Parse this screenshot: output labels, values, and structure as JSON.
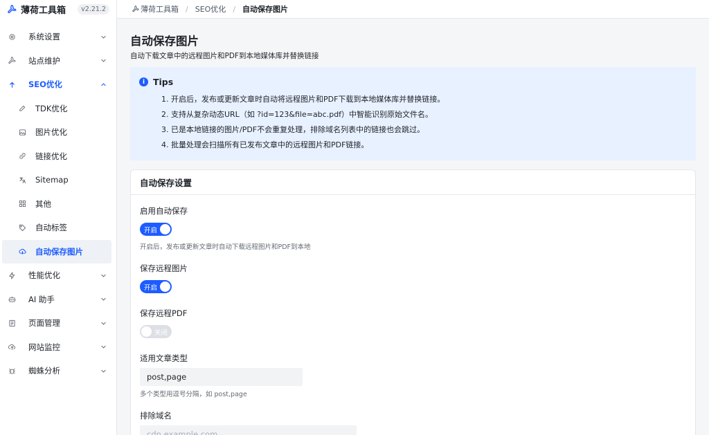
{
  "brand": {
    "name": "薄荷工具箱",
    "version": "v2.21.2"
  },
  "sidebar": {
    "items": [
      {
        "label": "系统设置",
        "icon": "gear-icon",
        "chevron": "down"
      },
      {
        "label": "站点维护",
        "icon": "wrench-icon",
        "chevron": "down"
      },
      {
        "label": "SEO优化",
        "icon": "arrow-up-icon",
        "chevron": "up",
        "active": true
      },
      {
        "label": "TDK优化",
        "icon": "pencil-icon",
        "sub": true
      },
      {
        "label": "图片优化",
        "icon": "image-icon",
        "sub": true
      },
      {
        "label": "链接优化",
        "icon": "link-icon",
        "sub": true
      },
      {
        "label": "Sitemap",
        "icon": "translate-icon",
        "sub": true
      },
      {
        "label": "其他",
        "icon": "grid-icon",
        "sub": true
      },
      {
        "label": "自动标签",
        "icon": "tag-icon",
        "sub": true
      },
      {
        "label": "自动保存图片",
        "icon": "cloud-save-icon",
        "sub": true,
        "selected": true
      },
      {
        "label": "性能优化",
        "icon": "bolt-icon",
        "chevron": "down"
      },
      {
        "label": "AI 助手",
        "icon": "robot-icon",
        "chevron": "down"
      },
      {
        "label": "页面管理",
        "icon": "page-icon",
        "chevron": "down"
      },
      {
        "label": "网站监控",
        "icon": "monitor-icon",
        "chevron": "down"
      },
      {
        "label": "蜘蛛分析",
        "icon": "bug-icon",
        "chevron": "down"
      }
    ]
  },
  "breadcrumb": {
    "home": "薄荷工具箱",
    "section": "SEO优化",
    "current": "自动保存图片"
  },
  "page": {
    "title": "自动保存图片",
    "subtitle": "自动下载文章中的远程图片和PDF到本地媒体库并替换链接"
  },
  "tips": {
    "title": "Tips",
    "items": [
      "1. 开启后，发布或更新文章时自动将远程图片和PDF下载到本地媒体库并替换链接。",
      "2. 支持从复杂动态URL（如 ?id=123&file=abc.pdf）中智能识别原始文件名。",
      "3. 已是本地链接的图片/PDF不会重复处理，排除域名列表中的链接也会跳过。",
      "4. 批量处理会扫描所有已发布文章中的远程图片和PDF链接。"
    ]
  },
  "settings": {
    "title": "自动保存设置",
    "enable": {
      "label": "启用自动保存",
      "toggle": "开启",
      "on": true,
      "hint": "开启后，发布或更新文章时自动下载远程图片和PDF到本地"
    },
    "save_images": {
      "label": "保存远程图片",
      "toggle": "开启",
      "on": true
    },
    "save_pdf": {
      "label": "保存远程PDF",
      "toggle": "关闭",
      "on": false
    },
    "post_types": {
      "label": "适用文章类型",
      "value": "post,page",
      "hint": "多个类型用逗号分隔，如 post,page"
    },
    "exclude": {
      "label": "排除域名",
      "placeholder": "cdn.example.com"
    }
  },
  "colors": {
    "accent": "#1d5cff",
    "tips_bg": "#e8f1ff",
    "toggle_off": "#dcdfe4"
  }
}
